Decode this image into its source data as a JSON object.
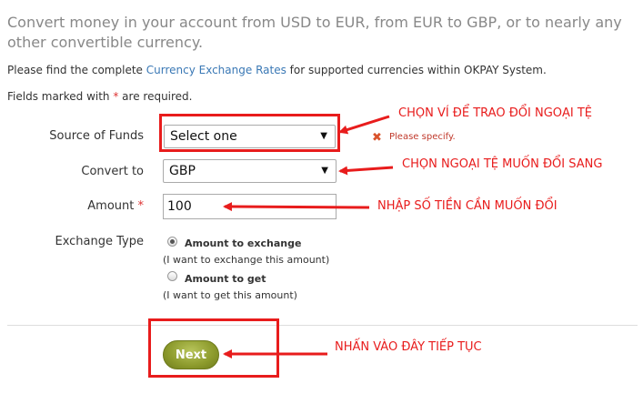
{
  "intro_text": "Convert money in your account from USD to EUR, from EUR to GBP, or to nearly any other convertible currency.",
  "find_line": {
    "prefix": "Please find the complete ",
    "link": "Currency Exchange Rates",
    "suffix": " for supported currencies within OKPAY System."
  },
  "required_line": {
    "prefix": "Fields marked with ",
    "star": "*",
    "suffix": " are required."
  },
  "form": {
    "source_of_funds": {
      "label": "Source of Funds",
      "value": "Select one",
      "error_text": "Please specify."
    },
    "convert_to": {
      "label": "Convert to",
      "value": "GBP"
    },
    "amount": {
      "label": "Amount",
      "star": "*",
      "value": "100"
    },
    "exchange_type": {
      "label": "Exchange Type",
      "options": [
        {
          "label": "Amount to exchange",
          "sub": "(I want to exchange this amount)",
          "selected": true
        },
        {
          "label": "Amount to get",
          "sub": "(I want to get this amount)",
          "selected": false
        }
      ]
    },
    "next_label": "Next"
  },
  "annotations": {
    "source": "CHỌN VÍ ĐỂ TRAO ĐỔI NGOẠI TỆ",
    "convert": "CHỌN NGOẠI TỆ MUỐN ĐỔI SANG",
    "amount": "NHẬP SỐ TIỀN CẦN MUỐN ĐỔI",
    "next": "NHẤN VÀO ĐÂY TIẾP TỤC"
  },
  "colors": {
    "annotation_red": "#e81c1c",
    "link_blue": "#3a78b5",
    "next_button_olive": "#8c9a2c"
  }
}
